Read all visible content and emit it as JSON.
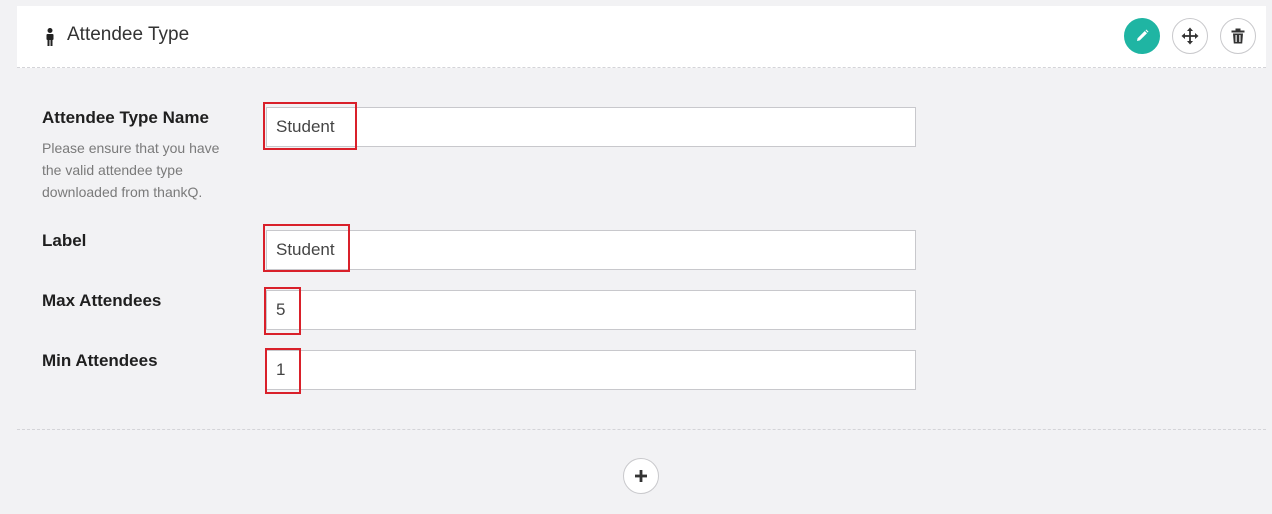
{
  "header": {
    "title": "Attendee Type",
    "icon": "person-icon",
    "actions": {
      "edit_icon": "pencil-icon",
      "move_icon": "move-arrows-icon",
      "delete_icon": "trash-icon"
    },
    "accent_color": "#1fb5a3"
  },
  "form": {
    "attendee_type_name": {
      "label": "Attendee Type Name",
      "help": "Please ensure that you have the valid attendee type downloaded from thankQ.",
      "value": "Student"
    },
    "label_field": {
      "label": "Label",
      "value": "Student"
    },
    "max_attendees": {
      "label": "Max Attendees",
      "value": "5"
    },
    "min_attendees": {
      "label": "Min Attendees",
      "value": "1"
    }
  },
  "footer": {
    "add_icon": "plus-icon"
  },
  "highlight_color": "#d9202a"
}
